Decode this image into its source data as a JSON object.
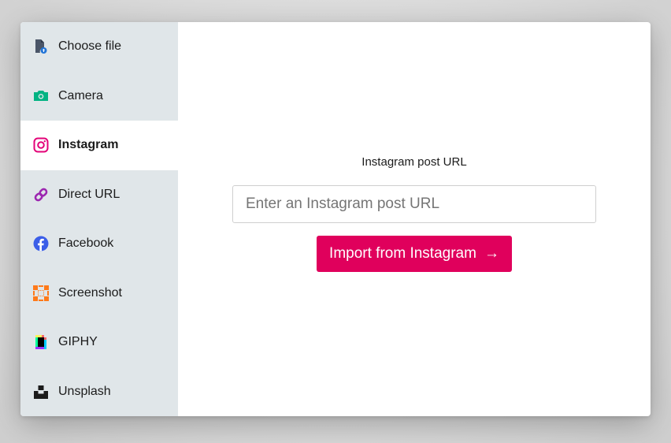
{
  "sidebar": {
    "items": [
      {
        "label": "Choose file",
        "icon": "file-upload-icon",
        "active": false,
        "color": "#2275d7"
      },
      {
        "label": "Camera",
        "icon": "camera-icon",
        "active": false,
        "color": "#02b383"
      },
      {
        "label": "Instagram",
        "icon": "instagram-icon",
        "active": true,
        "color": "#e30378"
      },
      {
        "label": "Direct URL",
        "icon": "link-icon",
        "active": false,
        "color": "#9c27b0"
      },
      {
        "label": "Facebook",
        "icon": "facebook-icon",
        "active": false,
        "color": "#3c5a99"
      },
      {
        "label": "Screenshot",
        "icon": "screenshot-icon",
        "active": false,
        "color": "#ff7a1a"
      },
      {
        "label": "GIPHY",
        "icon": "giphy-icon",
        "active": false,
        "color": "#000000"
      },
      {
        "label": "Unsplash",
        "icon": "unsplash-icon",
        "active": false,
        "color": "#000000"
      }
    ]
  },
  "main": {
    "field_label": "Instagram post URL",
    "input_placeholder": "Enter an Instagram post URL",
    "input_value": "",
    "button_label": "Import from Instagram",
    "button_arrow": "→",
    "accent_color": "#e0005c"
  }
}
